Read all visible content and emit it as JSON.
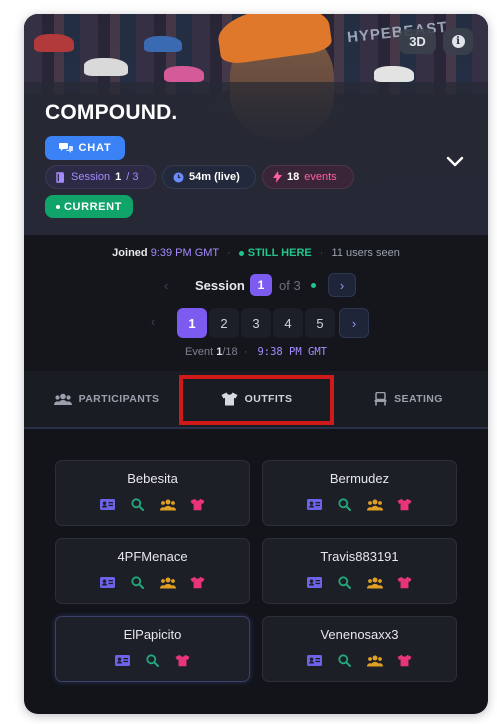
{
  "hero": {
    "title": "COMPOUND.",
    "badge_3d": "3D",
    "info_icon": "info-icon",
    "sign_text": "HYPEBEAST",
    "chat_label": "CHAT",
    "session_pill": {
      "label": "Session",
      "current": "1",
      "total": "/ 3"
    },
    "time_pill": "54m (live)",
    "events_pill": {
      "count": "18",
      "label": "events"
    },
    "current_label": "CURRENT",
    "expand_icon": "chevron-down-icon"
  },
  "meta": {
    "joined_label": "Joined",
    "joined_time": "9:39 PM GMT",
    "still_here": "STILL HERE",
    "users_seen": "11 users seen",
    "session_label": "Session",
    "session_current": "1",
    "session_of": "of 3",
    "pages": [
      "1",
      "2",
      "3",
      "4",
      "5"
    ],
    "active_page": "1",
    "event_label": "Event",
    "event_current": "1",
    "event_total": "/18",
    "event_time": "9:38 PM GMT"
  },
  "tabs": [
    {
      "label": "PARTICIPANTS",
      "icon": "users-icon"
    },
    {
      "label": "OUTFITS",
      "icon": "shirt-icon"
    },
    {
      "label": "SEATING",
      "icon": "chair-icon"
    }
  ],
  "participants": [
    {
      "name": "Bebesita",
      "icons": [
        "id-card",
        "search",
        "group",
        "shirt"
      ]
    },
    {
      "name": "Bermudez",
      "icons": [
        "id-card",
        "search",
        "group",
        "shirt"
      ]
    },
    {
      "name": "4PFMenace",
      "icons": [
        "id-card",
        "search",
        "group",
        "shirt"
      ]
    },
    {
      "name": "Travis883191",
      "icons": [
        "id-card",
        "search",
        "group",
        "shirt"
      ]
    },
    {
      "name": "ElPapicito",
      "icons": [
        "id-card",
        "search",
        "shirt"
      ]
    },
    {
      "name": "Venenosaxx3",
      "icons": [
        "id-card",
        "search",
        "group",
        "shirt"
      ]
    }
  ],
  "colors": {
    "accent_purple": "#7c5cf0",
    "chat_blue": "#3b82f6",
    "current_green": "#10a36a",
    "highlight_red": "#d01919",
    "icon_id": "#6c63e8",
    "icon_search": "#22a87a",
    "icon_group": "#e0a024",
    "icon_shirt": "#e8357a"
  }
}
